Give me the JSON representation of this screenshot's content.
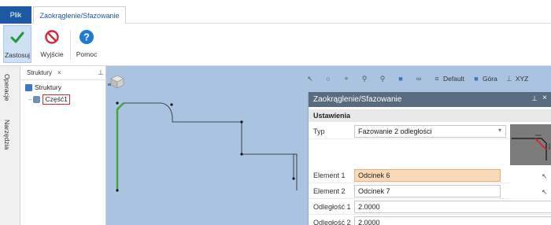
{
  "tabs": {
    "file": "Plik",
    "fillet": "Zaokrąglenie/Sfazowanie"
  },
  "ribbon": {
    "apply": "Zastosuj",
    "exit": "Wyjście",
    "help": "Pomoc"
  },
  "colors": {
    "accent_blue": "#1d5aa3",
    "apply_check": "#1e9a3a",
    "exit_red": "#d6263a",
    "help_blue": "#1f7ad6",
    "viewport_bg": "#a9c3e1",
    "profile_green": "#49a436",
    "highlight_orange": "#fbd9b8"
  },
  "sidetabs": {
    "operations": "Operacje",
    "tools": "Narzędzia"
  },
  "structure": {
    "tab_label": "Struktury",
    "close": "×",
    "pin": "⊥",
    "root": "Struktury",
    "part": "Część1"
  },
  "viewbar": {
    "default_label": "Default",
    "top_label": "Góra",
    "xyz_label": "XYZ",
    "icons": [
      "cursor-icon",
      "orbit-icon",
      "pan-icon",
      "zoom-icon",
      "zoom-window-icon",
      "cube-icon",
      "visibility-icon"
    ]
  },
  "panel": {
    "title": "Zaokrąglenie/Sfazowanie",
    "pin": "⊥",
    "close": "×",
    "section": "Ustawienia",
    "type_label": "Typ",
    "type_value": "Fazowanie 2 odległości",
    "element1_label": "Element 1",
    "element1_value": "Odcinek 6",
    "element2_label": "Element 2",
    "element2_value": "Odcinek 7",
    "dist1_label": "Odległość 1",
    "dist1_value": "2.0000",
    "dist2_label": "Odległość 2",
    "dist2_value": "2.0000"
  }
}
